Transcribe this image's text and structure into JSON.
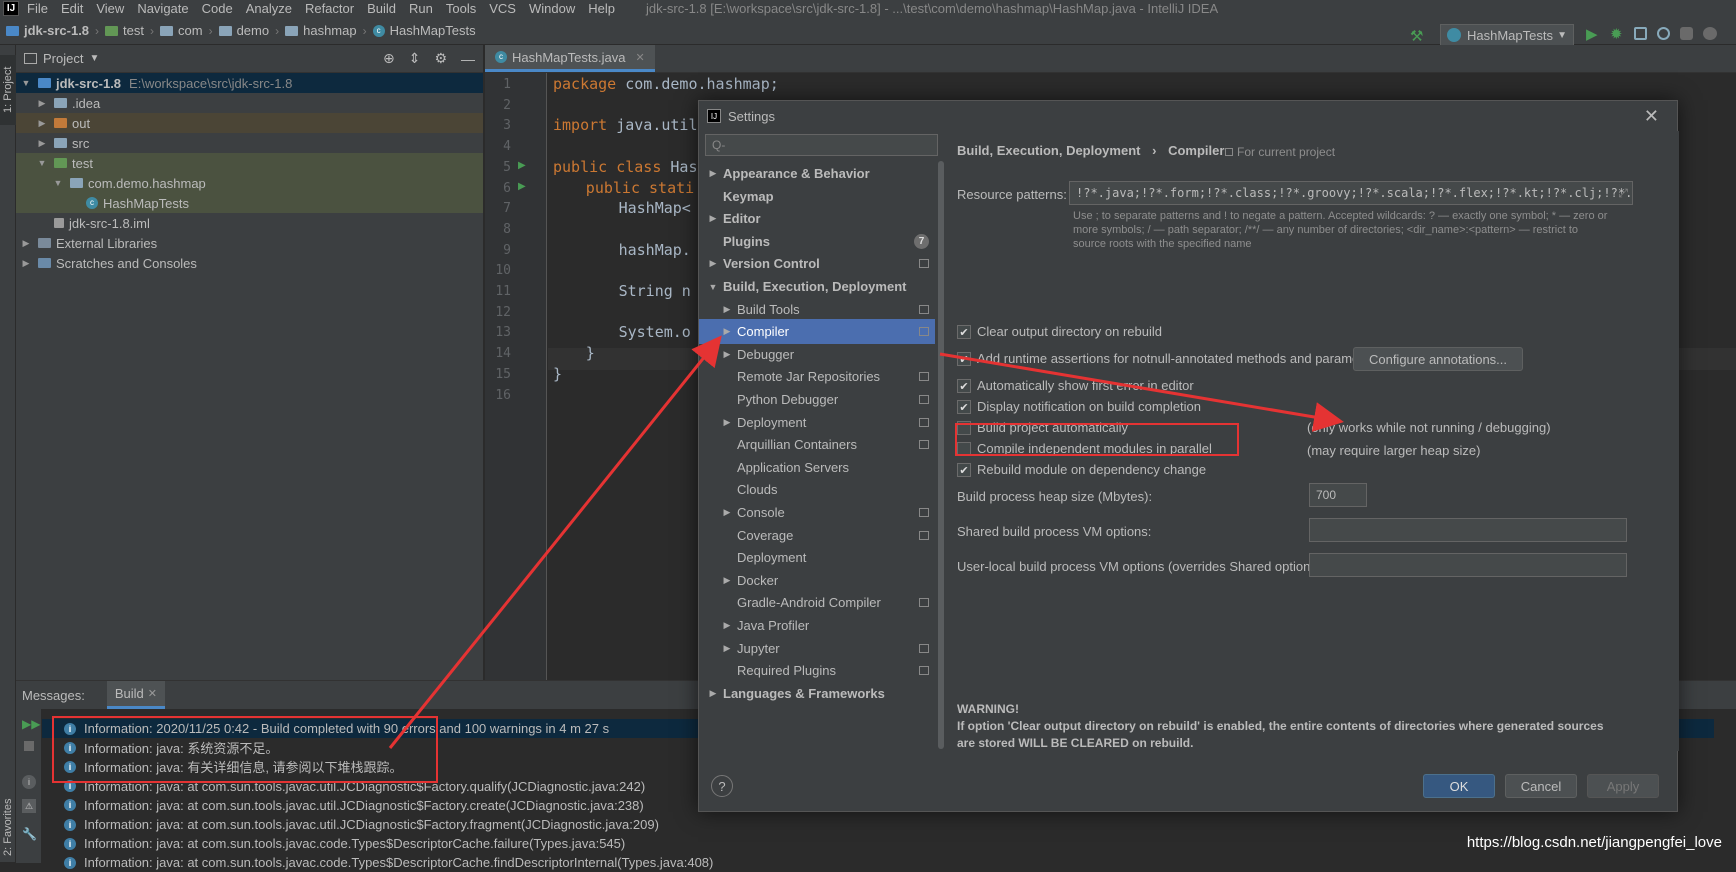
{
  "menubar": {
    "items": [
      "File",
      "Edit",
      "View",
      "Navigate",
      "Code",
      "Analyze",
      "Refactor",
      "Build",
      "Run",
      "Tools",
      "VCS",
      "Window",
      "Help"
    ],
    "window_title": "jdk-src-1.8 [E:\\workspace\\src\\jdk-src-1.8] - ...\\test\\com\\demo\\hashmap\\HashMap.java - IntelliJ IDEA"
  },
  "breadcrumbs": [
    "jdk-src-1.8",
    "test",
    "com",
    "demo",
    "hashmap",
    "HashMapTests"
  ],
  "run_config": "HashMapTests",
  "left_tabs": {
    "project": "1: Project",
    "favorites": "2: Favorites"
  },
  "project": {
    "header": "Project",
    "tree": [
      {
        "label": "jdk-src-1.8",
        "path": "E:\\workspace\\src\\jdk-src-1.8",
        "level": 0,
        "open": true
      },
      {
        "label": ".idea",
        "level": 1,
        "open": false
      },
      {
        "label": "out",
        "level": 1,
        "open": false
      },
      {
        "label": "src",
        "level": 1,
        "open": false
      },
      {
        "label": "test",
        "level": 1,
        "open": true
      },
      {
        "label": "com.demo.hashmap",
        "level": 2,
        "open": true
      },
      {
        "label": "HashMapTests",
        "level": 3
      },
      {
        "label": "jdk-src-1.8.iml",
        "level": 1
      },
      {
        "label": "External Libraries",
        "level": 0,
        "open": false
      },
      {
        "label": "Scratches and Consoles",
        "level": 0,
        "open": false
      }
    ]
  },
  "editor": {
    "tab": "HashMapTests.java",
    "line_numbers": [
      "1",
      "2",
      "3",
      "4",
      "5",
      "6",
      "7",
      "8",
      "9",
      "10",
      "11",
      "12",
      "13",
      "14",
      "15",
      "16"
    ],
    "lines": {
      "l1_kw": "package",
      "l1": " com.demo.hashmap;",
      "l3_kw": "import",
      "l3": " java.util",
      "l5_kw": "public class",
      "l5": " Has",
      "l6_kw": "public stati",
      "l6": "",
      "l7": "HashMap<",
      "l9": "hashMap.",
      "l11": "String n",
      "l13": "System.o",
      "l14": "}",
      "l15": "}"
    }
  },
  "messages": {
    "header": "Messages:",
    "tab": "Build",
    "rows": [
      "Information: 2020/11/25 0:42 - Build completed with 90 errors and 100 warnings in 4 m 27 s",
      "Information: java: 系统资源不足。",
      "Information: java: 有关详细信息, 请参阅以下堆栈跟踪。",
      "Information: java: at com.sun.tools.javac.util.JCDiagnostic$Factory.qualify(JCDiagnostic.java:242)",
      "Information: java: at com.sun.tools.javac.util.JCDiagnostic$Factory.create(JCDiagnostic.java:238)",
      "Information: java: at com.sun.tools.javac.util.JCDiagnostic$Factory.fragment(JCDiagnostic.java:209)",
      "Information: java: at com.sun.tools.javac.code.Types$DescriptorCache.failure(Types.java:545)",
      "Information: java: at com.sun.tools.javac.code.Types$DescriptorCache.findDescriptorInternal(Types.java:408)"
    ]
  },
  "settings": {
    "title": "Settings",
    "search_placeholder": "Q-",
    "nav": [
      {
        "label": "Appearance & Behavior",
        "bold": true,
        "tw": "▶",
        "indent": 0
      },
      {
        "label": "Keymap",
        "bold": true,
        "tw": "",
        "indent": 0
      },
      {
        "label": "Editor",
        "bold": true,
        "tw": "▶",
        "indent": 0
      },
      {
        "label": "Plugins",
        "bold": true,
        "tw": "",
        "indent": 0,
        "badge": "7"
      },
      {
        "label": "Version Control",
        "bold": true,
        "tw": "▶",
        "indent": 0,
        "copy": true
      },
      {
        "label": "Build, Execution, Deployment",
        "bold": true,
        "tw": "▼",
        "indent": 0
      },
      {
        "label": "Build Tools",
        "tw": "▶",
        "indent": 1,
        "copy": true
      },
      {
        "label": "Compiler",
        "tw": "▶",
        "indent": 1,
        "copy": true,
        "sel": true
      },
      {
        "label": "Debugger",
        "tw": "▶",
        "indent": 1
      },
      {
        "label": "Remote Jar Repositories",
        "tw": "",
        "indent": 1,
        "copy": true
      },
      {
        "label": "Python Debugger",
        "tw": "",
        "indent": 1,
        "copy": true
      },
      {
        "label": "Deployment",
        "tw": "▶",
        "indent": 1,
        "copy": true
      },
      {
        "label": "Arquillian Containers",
        "tw": "",
        "indent": 1,
        "copy": true
      },
      {
        "label": "Application Servers",
        "tw": "",
        "indent": 1
      },
      {
        "label": "Clouds",
        "tw": "",
        "indent": 1
      },
      {
        "label": "Console",
        "tw": "▶",
        "indent": 1,
        "copy": true
      },
      {
        "label": "Coverage",
        "tw": "",
        "indent": 1,
        "copy": true
      },
      {
        "label": "Deployment",
        "tw": "",
        "indent": 1
      },
      {
        "label": "Docker",
        "tw": "▶",
        "indent": 1
      },
      {
        "label": "Gradle-Android Compiler",
        "tw": "",
        "indent": 1,
        "copy": true
      },
      {
        "label": "Java Profiler",
        "tw": "▶",
        "indent": 1
      },
      {
        "label": "Jupyter",
        "tw": "▶",
        "indent": 1,
        "copy": true
      },
      {
        "label": "Required Plugins",
        "tw": "",
        "indent": 1,
        "copy": true
      },
      {
        "label": "Languages & Frameworks",
        "bold": true,
        "tw": "▶",
        "indent": 0
      }
    ],
    "breadcrumb_parent": "Build, Execution, Deployment",
    "breadcrumb_sep": "›",
    "breadcrumb_current": "Compiler",
    "scope": "For current project",
    "resource_patterns_label": "Resource patterns:",
    "resource_patterns_value": "!?*.java;!?*.form;!?*.class;!?*.groovy;!?*.scala;!?*.flex;!?*.kt;!?*.clj;!?*.aj",
    "hint_line1": "Use ; to separate patterns and ! to negate a pattern. Accepted wildcards: ? — exactly one symbol; * — zero or",
    "hint_line2": "more symbols; / — path separator; /**/ — any number of directories; <dir_name>:<pattern> — restrict to",
    "hint_line3": "source roots with the specified name",
    "checkboxes": [
      {
        "label": "Clear output directory on rebuild",
        "checked": true
      },
      {
        "label": "Add runtime assertions for notnull-annotated methods and parameters",
        "checked": true
      },
      {
        "label": "Automatically show first error in editor",
        "checked": true
      },
      {
        "label": "Display notification on build completion",
        "checked": true
      },
      {
        "label": "Build project automatically",
        "checked": false
      },
      {
        "label": "Compile independent modules in parallel",
        "checked": false
      },
      {
        "label": "Rebuild module on dependency change",
        "checked": true
      }
    ],
    "configure_annotations": "Configure annotations...",
    "note_auto": "(only works while not running / debugging)",
    "note_parallel": "(may require larger heap size)",
    "heap_label": "Build process heap size (Mbytes):",
    "heap_value": "700",
    "shared_vm_label": "Shared build process VM options:",
    "shared_vm_value": "",
    "user_vm_label": "User-local build process VM options (overrides Shared options):",
    "user_vm_value": "",
    "warning_title": "WARNING!",
    "warning_line1": "If option 'Clear output directory on rebuild' is enabled, the entire contents of directories where generated sources",
    "warning_line2": "are stored WILL BE CLEARED on rebuild.",
    "help": "?",
    "ok": "OK",
    "cancel": "Cancel",
    "apply": "Apply"
  },
  "colors": {
    "annotation": "#e53333",
    "selection": "#4b6eaf",
    "accent": "#4a88c7"
  },
  "watermark": "https://blog.csdn.net/jiangpengfei_love"
}
